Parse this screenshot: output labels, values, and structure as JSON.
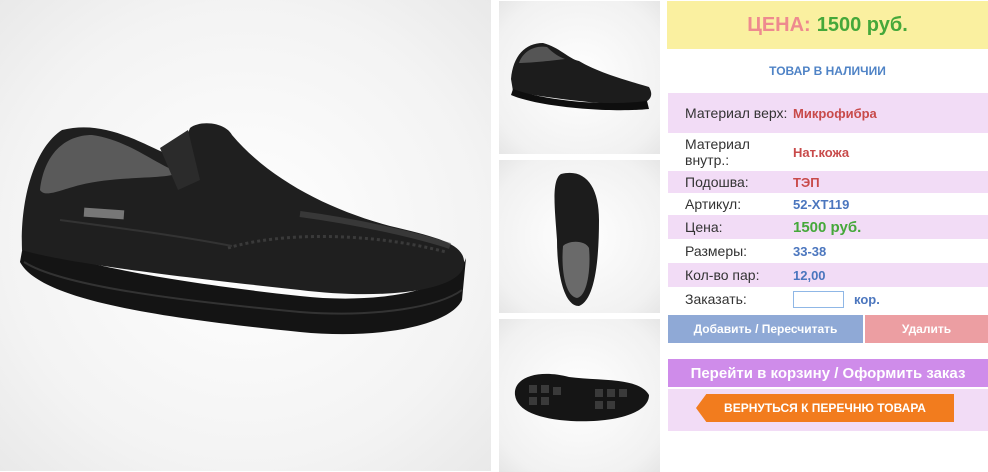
{
  "price": {
    "label": "ЦЕНА:",
    "value": "1500 руб."
  },
  "stock_status": "ТОВАР В НАЛИЧИИ",
  "specs": [
    {
      "key": "Материал верх:",
      "value": "Микрофибра"
    },
    {
      "key": "Материал внутр.:",
      "value": "Нат.кожа"
    },
    {
      "key": "Подошва:",
      "value": "ТЭП"
    },
    {
      "key": "Артикул:",
      "value": "52-ХТ119"
    },
    {
      "key": "Цена:",
      "value": "1500 руб."
    },
    {
      "key": "Размеры:",
      "value": "33-38"
    },
    {
      "key": "Кол-во пар:",
      "value": "12,00"
    }
  ],
  "order": {
    "label": "Заказать:",
    "value": "",
    "unit": "кор."
  },
  "buttons": {
    "add": "Добавить / Пересчитать",
    "delete": "Удалить",
    "cart": "Перейти в корзину / Оформить заказ",
    "back": "ВЕРНУТЬСЯ К ПЕРЕЧНЮ ТОВАРА"
  },
  "colors": {
    "price_label": "#ee8a8f",
    "price_value": "#45a83a",
    "accent_blue": "#4b76be",
    "pink_row": "#f2dcf6",
    "cart": "#cf8cea",
    "back": "#f27c1e"
  }
}
